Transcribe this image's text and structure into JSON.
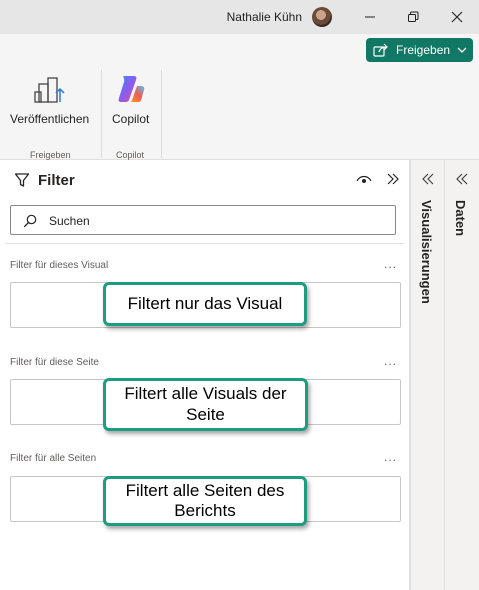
{
  "titlebar": {
    "user_name": "Nathalie Kühn",
    "minimize_icon": "minimize-icon",
    "restore_icon": "restore-icon",
    "close_icon": "close-icon"
  },
  "share": {
    "label": "Freigeben",
    "color": "#117865"
  },
  "ribbon": {
    "groups": [
      {
        "button_label": "Veröffentlichen",
        "group_label": "Freigeben",
        "icon": "publish-icon"
      },
      {
        "button_label": "Copilot",
        "group_label": "Copilot",
        "icon": "copilot-icon"
      }
    ]
  },
  "filter_pane": {
    "title": "Filter",
    "search_placeholder": "Suchen",
    "sections": [
      {
        "label": "Filter für dieses Visual",
        "more": "...",
        "callout": "Filtert nur das Visual"
      },
      {
        "label": "Filter für diese Seite",
        "more": "...",
        "callout": "Filtert alle Visuals der Seite"
      },
      {
        "label": "Filter für alle Seiten",
        "more": "...",
        "callout": "Filtert alle Seiten des Berichts"
      }
    ],
    "callout_border_color": "#1a9e7e"
  },
  "side_panes": {
    "visualisierungen": "Visualisierungen",
    "daten": "Daten"
  }
}
